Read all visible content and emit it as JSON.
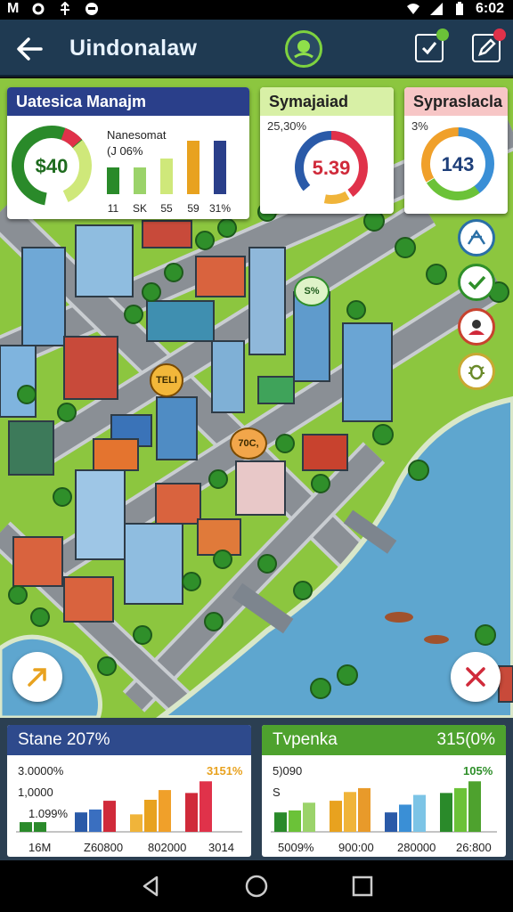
{
  "status_bar": {
    "left_text": "M",
    "time": "6:02"
  },
  "app_bar": {
    "title": "Uindonalaw"
  },
  "cards": {
    "main": {
      "title": "Uatesica Manajm",
      "donut_value": "$40",
      "note_line1": "Nanesomat",
      "note_line2": "(J 06%",
      "bar_labels": [
        "11",
        "SK",
        "55",
        "59",
        "31%"
      ],
      "header_color": "#2a3f8a"
    },
    "second": {
      "title": "Symajaiad",
      "percent": "25,30%",
      "donut_value": "5.39",
      "header_color": "#d8f0a6"
    },
    "third": {
      "title": "Sypraslacla",
      "percent": "3%",
      "donut_value": "143",
      "header_color": "#f7c6c6"
    }
  },
  "map_labels": {
    "bubble1": "TELI",
    "bubble2": "70C,",
    "bubble3": "S%"
  },
  "panels": {
    "left": {
      "title": "Stane 207%",
      "header_color": "#2e4a8c",
      "ylabels": [
        "3.0000%",
        "1,0000",
        "1.099%"
      ],
      "highlight": "3151%",
      "xlabels": [
        "16M",
        "Z60800",
        "802000",
        "3014"
      ]
    },
    "right": {
      "title": "Tvpenka",
      "value": "315(0%",
      "header_color": "#4ea22e",
      "ylabels": [
        "5)090",
        "S"
      ],
      "highlight": "105%",
      "xlabels": [
        "5009%",
        "900:00",
        "280000",
        "26:800"
      ]
    }
  },
  "icons": {
    "back": "back-arrow-icon",
    "logo": "app-logo-icon",
    "check": "checklist-icon",
    "edit": "edit-icon",
    "fab_left": "arrow-tool-icon",
    "fab_right": "close-icon"
  },
  "chart_data": [
    {
      "type": "bar",
      "title": "Uatesica Manajm",
      "categories": [
        "11",
        "SK",
        "55",
        "59",
        "31%"
      ],
      "values": [
        3,
        3,
        4,
        6,
        6
      ],
      "colors": [
        "#2a8a2a",
        "#9bd36a",
        "#cfe87a",
        "#e8a21f",
        "#2a3f8a"
      ]
    },
    {
      "type": "bar",
      "title": "Stane 207%",
      "categories": [
        "16M",
        "Z60800",
        "802000",
        "3014"
      ],
      "series": [
        {
          "values": [
            1,
            1
          ]
        },
        {
          "values": [
            2,
            2.3,
            3.2
          ]
        },
        {
          "values": [
            1.8,
            3.3,
            4.3
          ]
        },
        {
          "values": [
            4.0,
            5.2
          ]
        }
      ]
    },
    {
      "type": "bar",
      "title": "Tvpenka",
      "categories": [
        "5009%",
        "900:00",
        "280000",
        "26:800"
      ],
      "series": [
        {
          "values": [
            2,
            2.2,
            3.0
          ]
        },
        {
          "values": [
            3.2,
            4.1,
            4.5
          ]
        },
        {
          "values": [
            2.0,
            2.8,
            3.8
          ]
        },
        {
          "values": [
            4.0,
            4.5,
            5.2
          ]
        }
      ]
    }
  ]
}
